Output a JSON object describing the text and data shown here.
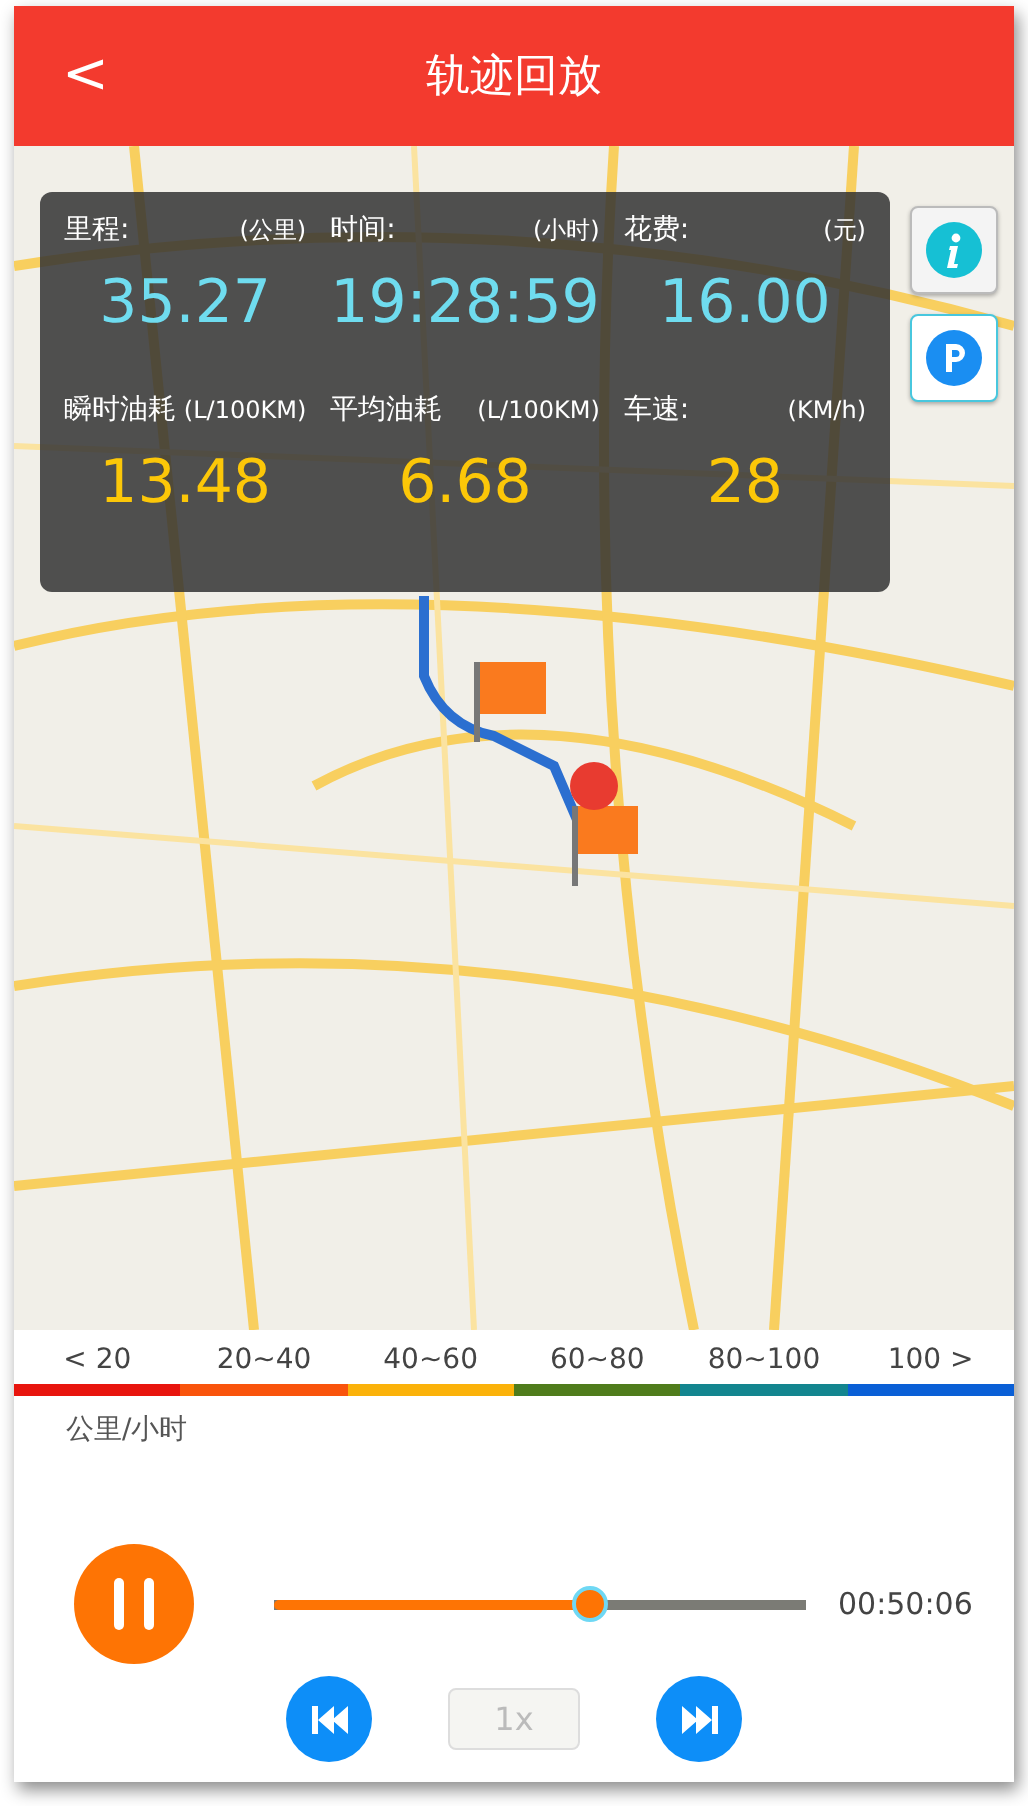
{
  "header": {
    "back": "<",
    "title": "轨迹回放"
  },
  "stats": [
    {
      "label": "里程:",
      "unit": "(公里)",
      "value": "35.27",
      "kind": "primary"
    },
    {
      "label": "时间:",
      "unit": "(小时)",
      "value": "19:28:59",
      "kind": "primary"
    },
    {
      "label": "花费:",
      "unit": "(元)",
      "value": "16.00",
      "kind": "primary"
    },
    {
      "label": "瞬时油耗",
      "unit": "(L/100KM)",
      "value": "13.48",
      "kind": "secondary"
    },
    {
      "label": "平均油耗",
      "unit": "(L/100KM)",
      "value": "6.68",
      "kind": "secondary"
    },
    {
      "label": "车速:",
      "unit": "(KM/h)",
      "value": "28",
      "kind": "secondary"
    }
  ],
  "legend": [
    {
      "label": "< 20",
      "color": "#e8150e"
    },
    {
      "label": "20~40",
      "color": "#f9540c"
    },
    {
      "label": "40~60",
      "color": "#fbb20a"
    },
    {
      "label": "60~80",
      "color": "#4f7c1c"
    },
    {
      "label": "80~100",
      "color": "#13858f"
    },
    {
      "label": "100 >",
      "color": "#0a5fd6"
    }
  ],
  "unit_note": "公里/小时",
  "player": {
    "playing": true,
    "level": 0.59,
    "time": "00:50:06",
    "speed": "1x",
    "speed_disabled": true
  }
}
